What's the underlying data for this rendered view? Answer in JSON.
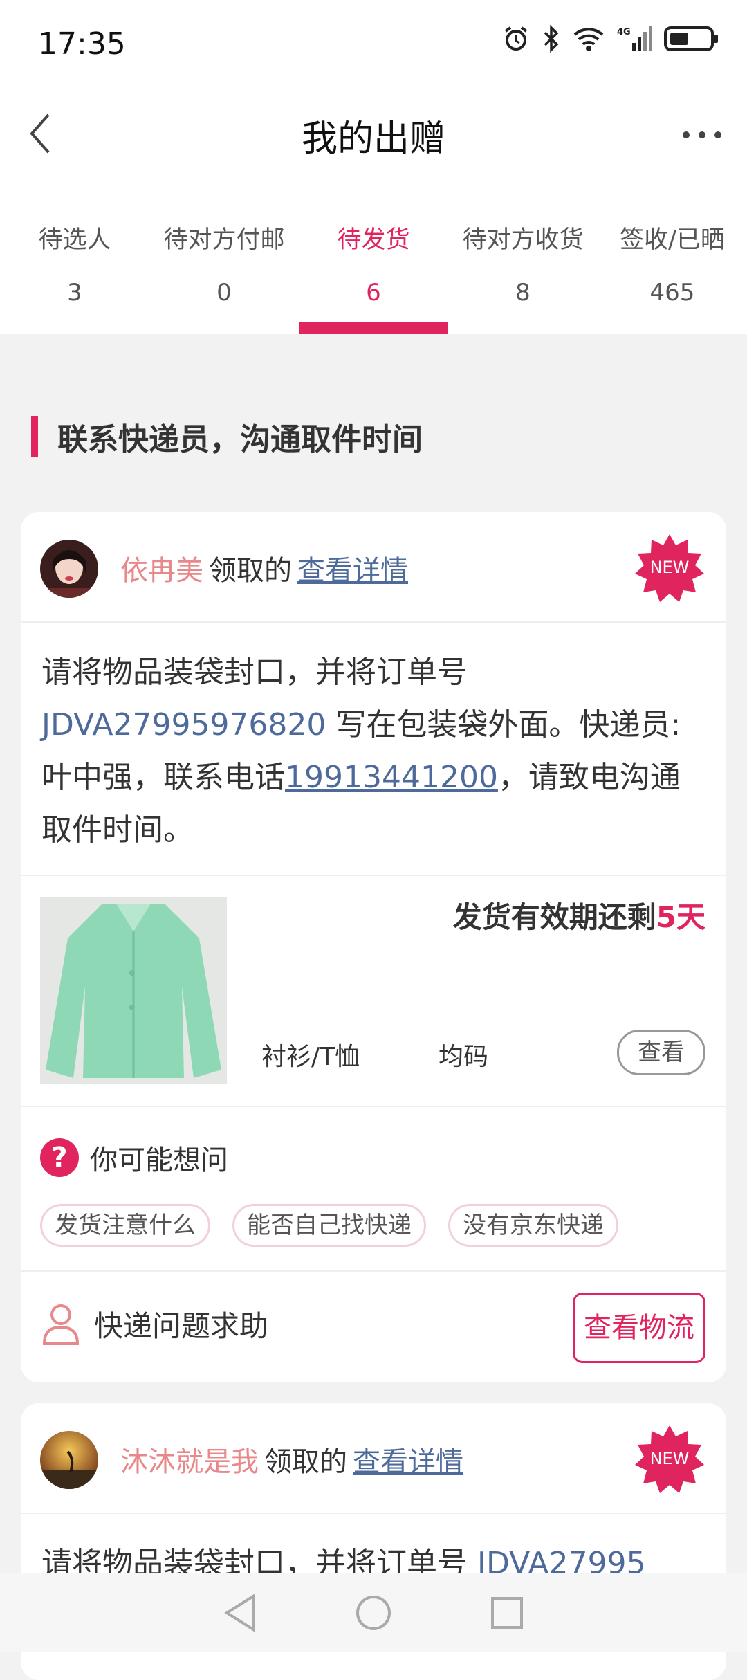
{
  "status": {
    "time": "17:35"
  },
  "nav": {
    "title": "我的出赠"
  },
  "tabs": [
    {
      "label": "待选人",
      "count": "3"
    },
    {
      "label": "待对方付邮",
      "count": "0"
    },
    {
      "label": "待发货",
      "count": "6"
    },
    {
      "label": "待对方收货",
      "count": "8"
    },
    {
      "label": "签收/已晒",
      "count": "465"
    }
  ],
  "section": {
    "title": "联系快递员，沟通取件时间"
  },
  "cards": [
    {
      "name": "依冉美",
      "claimed": "领取的",
      "detail_link": "查看详情",
      "badge": "NEW",
      "body_before_order": "请将物品装袋封口，并将订单号 ",
      "order_no": "JDVA27995976820",
      "body_mid": " 写在包装袋外面。快递员:叶中强，联系电话",
      "phone": "19913441200",
      "body_after": "，请致电沟通取件时间。",
      "deadline_text": "发货有效期还剩",
      "deadline_days": "5天",
      "category": "衬衫/T恤",
      "size": "均码",
      "view_label": "查看",
      "faq_title": "你可能想问",
      "faq_chips": [
        "发货注意什么",
        "能否自己找快递",
        "没有京东快递"
      ],
      "help_label": "快递问题求助",
      "logistics_label": "查看物流"
    },
    {
      "name": "沐沐就是我",
      "claimed": "领取的",
      "detail_link": "查看详情",
      "badge": "NEW",
      "body_before_order": "请将物品装袋封口，并将订单号 ",
      "order_no": "JDVA27995"
    }
  ],
  "colors": {
    "accent": "#e0245e",
    "link": "#4d6a9a",
    "name": "#e8888a"
  }
}
